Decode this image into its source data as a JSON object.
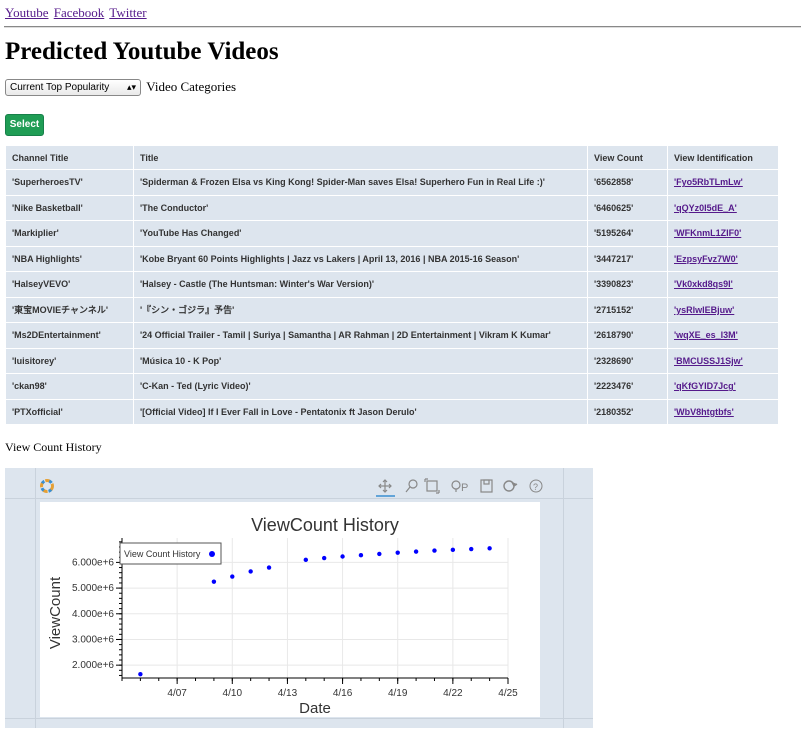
{
  "nav": {
    "links": [
      "Youtube",
      "Facebook",
      "Twitter"
    ]
  },
  "page_title": "Predicted Youtube Videos",
  "category_select": {
    "value": "Current Top Popularity",
    "label": "Video Categories"
  },
  "select_button": "Select",
  "table": {
    "headers": [
      "Channel Title",
      "Title",
      "View Count",
      "View Identification"
    ],
    "rows": [
      [
        "'SuperheroesTV'",
        "'Spiderman & Frozen Elsa vs King Kong! Spider-Man saves Elsa! Superhero Fun in Real Life :)'",
        "'6562858'",
        "'Fyo5RbTLmLw'"
      ],
      [
        "'Nike Basketball'",
        "'The Conductor'",
        "'6460625'",
        "'qQYz0I5dE_A'"
      ],
      [
        "'Markiplier'",
        "'YouTube Has Changed'",
        "'5195264'",
        "'WFKnmL1ZIF0'"
      ],
      [
        "'NBA Highlights'",
        "'Kobe Bryant 60 Points Highlights | Jazz vs Lakers | April 13, 2016 | NBA 2015-16 Season'",
        "'3447217'",
        "'EzpsyFvz7W0'"
      ],
      [
        "'HalseyVEVO'",
        "'Halsey - Castle (The Huntsman: Winter's War Version)'",
        "'3390823'",
        "'Vk0xkd8qs9I'"
      ],
      [
        "'東宝MOVIEチャンネル'",
        "'『シン・ゴジラ』予告'",
        "'2715152'",
        "'ysRlwlEBjuw'"
      ],
      [
        "'Ms2DEntertainment'",
        "'24 Official Trailer - Tamil | Suriya | Samantha | AR Rahman | 2D Entertainment | Vikram K Kumar'",
        "'2618790'",
        "'wqXE_es_l3M'"
      ],
      [
        "'luisitorey'",
        "'Música 10 - K Pop'",
        "'2328690'",
        "'BMCUSSJ1Sjw'"
      ],
      [
        "'ckan98'",
        "'C-Kan - Ted (Lyric Video)'",
        "'2223476'",
        "'qKfGYID7Jcg'"
      ],
      [
        "'PTXofficial'",
        "'[Official Video] If I Ever Fall in Love - Pentatonix ft Jason Derulo'",
        "'2180352'",
        "'WbV8htgtbfs'"
      ]
    ]
  },
  "history_label": "View Count History",
  "toolbar": {
    "icons": [
      "pan-icon",
      "lasso-icon",
      "box-zoom-icon",
      "wheel-zoom-icon",
      "save-icon",
      "reset-icon",
      "help-icon"
    ]
  },
  "chart_data": {
    "type": "scatter",
    "title": "ViewCount History",
    "xlabel": "Date",
    "ylabel": "ViewCount",
    "legend": {
      "label": "View Count History",
      "position": "top-left"
    },
    "x_ticks": [
      "4/07",
      "4/10",
      "4/13",
      "4/16",
      "4/19",
      "4/22",
      "4/25"
    ],
    "y_ticks": [
      "2.000e+6",
      "3.000e+6",
      "4.000e+6",
      "5.000e+6",
      "6.000e+6"
    ],
    "xlim": [
      "2016-04-04",
      "2016-04-25"
    ],
    "ylim": [
      1500000,
      6950000
    ],
    "grid": true,
    "color": "#0000ff",
    "points": [
      {
        "x": "2016-04-05",
        "y": 1650000
      },
      {
        "x": "2016-04-09",
        "y": 5250000
      },
      {
        "x": "2016-04-10",
        "y": 5450000
      },
      {
        "x": "2016-04-11",
        "y": 5650000
      },
      {
        "x": "2016-04-12",
        "y": 5800000
      },
      {
        "x": "2016-04-14",
        "y": 6100000
      },
      {
        "x": "2016-04-15",
        "y": 6170000
      },
      {
        "x": "2016-04-16",
        "y": 6230000
      },
      {
        "x": "2016-04-17",
        "y": 6280000
      },
      {
        "x": "2016-04-18",
        "y": 6330000
      },
      {
        "x": "2016-04-19",
        "y": 6380000
      },
      {
        "x": "2016-04-20",
        "y": 6420000
      },
      {
        "x": "2016-04-21",
        "y": 6460000
      },
      {
        "x": "2016-04-22",
        "y": 6490000
      },
      {
        "x": "2016-04-23",
        "y": 6520000
      },
      {
        "x": "2016-04-24",
        "y": 6550000
      }
    ]
  }
}
